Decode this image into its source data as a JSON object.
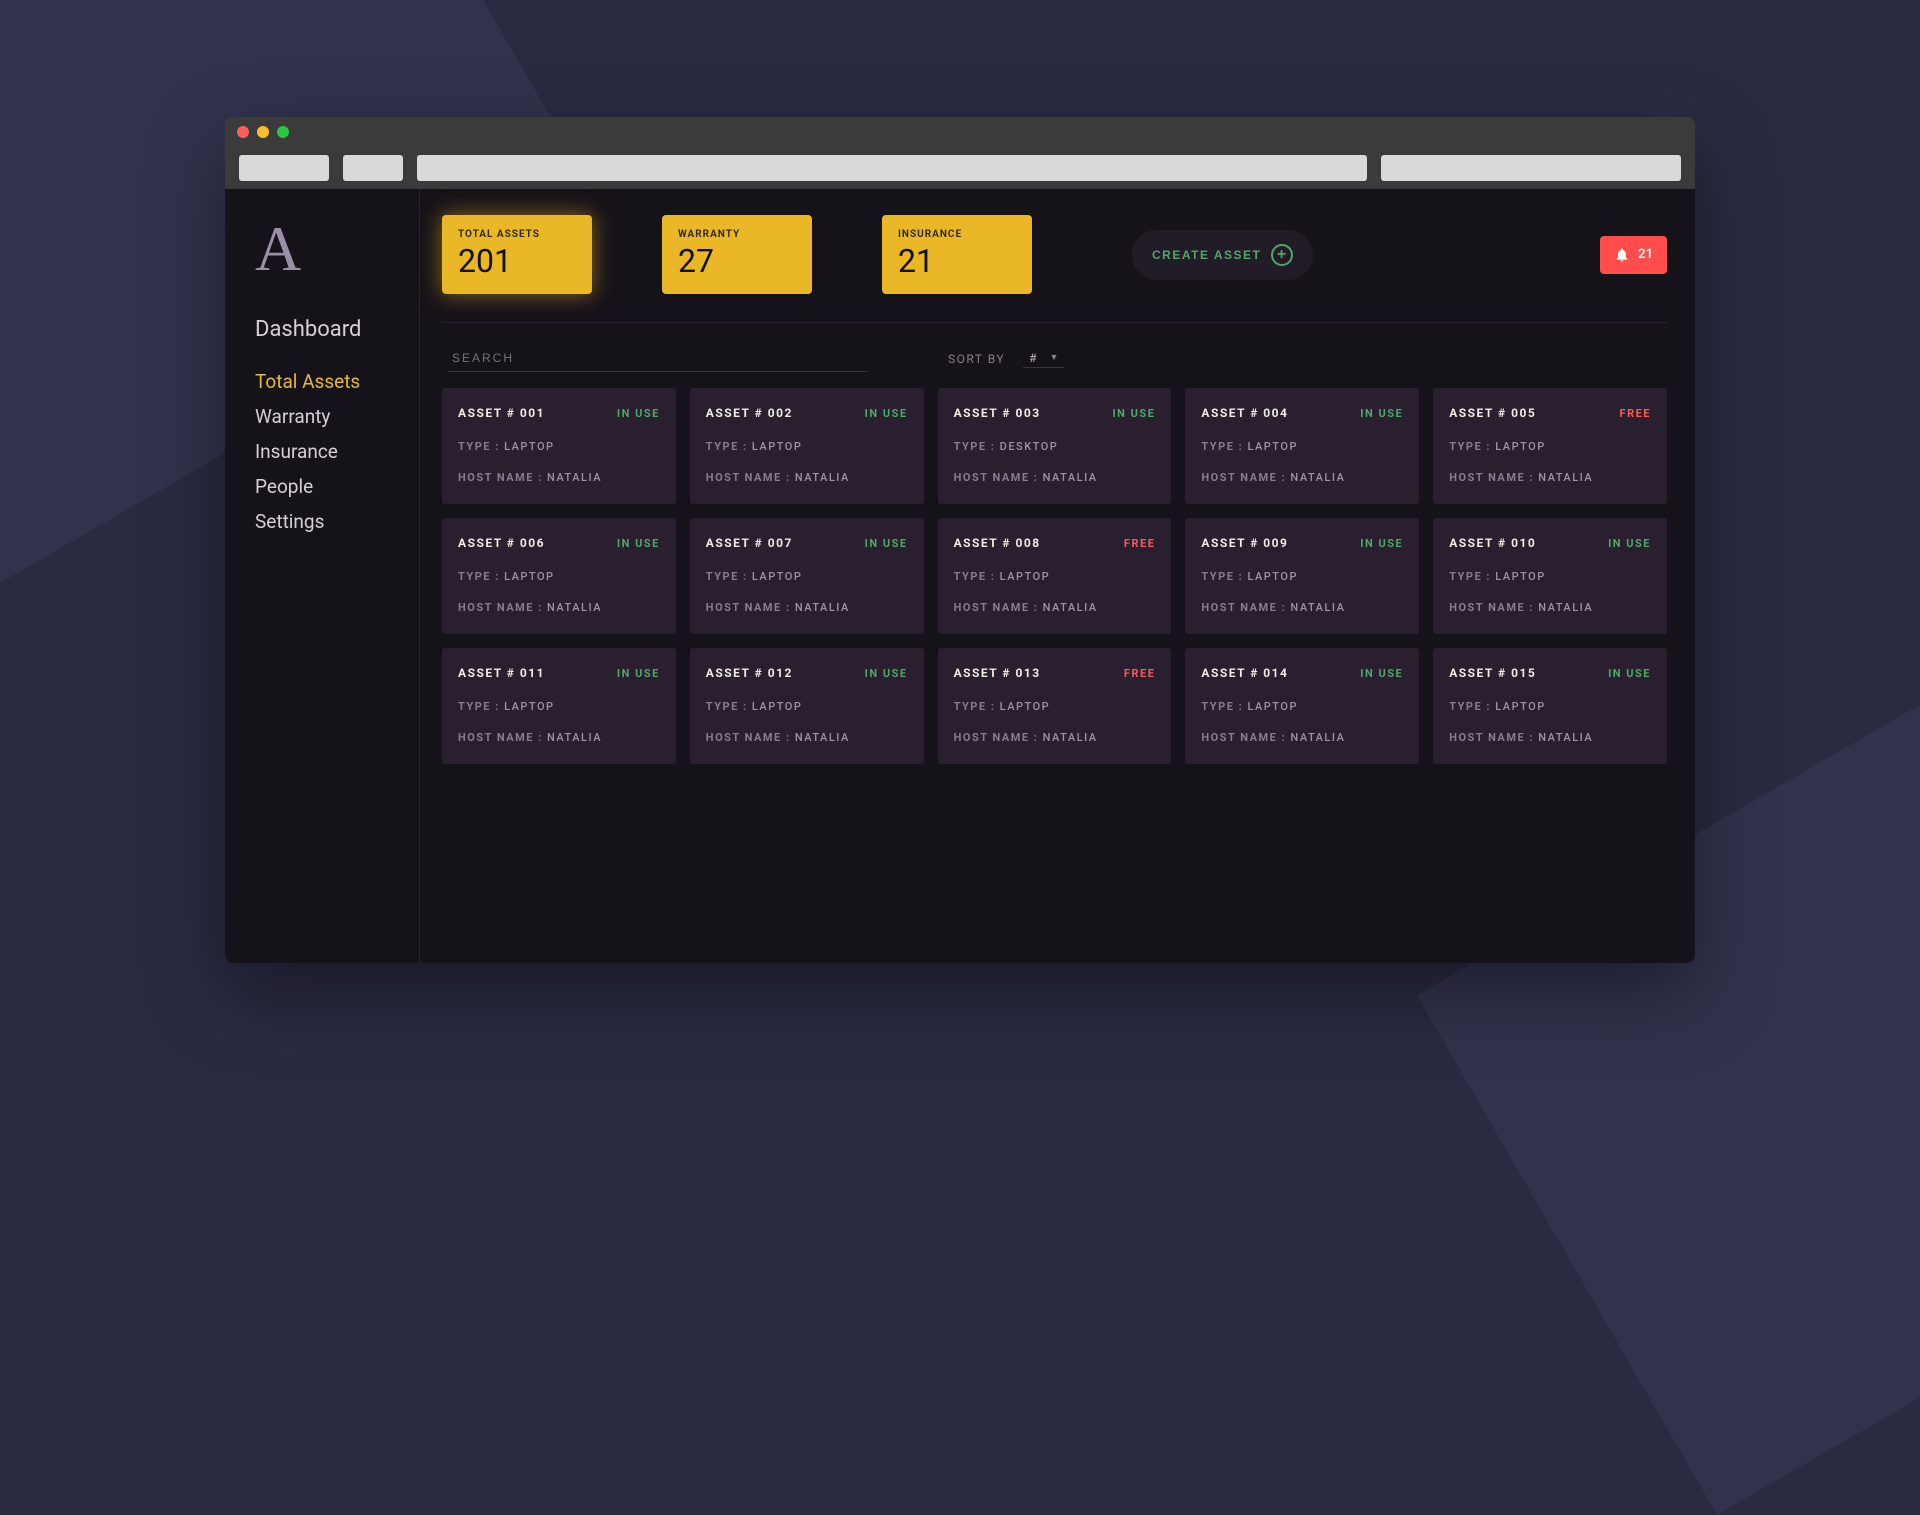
{
  "logo": "A",
  "nav": {
    "dashboard": "Dashboard",
    "total_assets": "Total Assets",
    "warranty": "Warranty",
    "insurance": "Insurance",
    "people": "People",
    "settings": "Settings"
  },
  "stats": {
    "total_assets": {
      "label": "TOTAL ASSETS",
      "value": "201"
    },
    "warranty": {
      "label": "WARRANTY",
      "value": "27"
    },
    "insurance": {
      "label": "INSURANCE",
      "value": "21"
    }
  },
  "create_label": "CREATE ASSET",
  "notif_count": "21",
  "search_placeholder": "SEARCH",
  "sort_label": "SORT BY",
  "sort_value": "#",
  "labels": {
    "type": "TYPE :",
    "host": "HOST NAME :"
  },
  "assets": [
    {
      "id": "ASSET # 001",
      "status": "IN USE",
      "status_kind": "inuse",
      "type": "LAPTOP",
      "host": "NATALIA"
    },
    {
      "id": "ASSET # 002",
      "status": "IN USE",
      "status_kind": "inuse",
      "type": "LAPTOP",
      "host": "NATALIA"
    },
    {
      "id": "ASSET # 003",
      "status": "IN USE",
      "status_kind": "inuse",
      "type": "DESKTOP",
      "host": "NATALIA"
    },
    {
      "id": "ASSET # 004",
      "status": "IN USE",
      "status_kind": "inuse",
      "type": "LAPTOP",
      "host": "NATALIA"
    },
    {
      "id": "ASSET # 005",
      "status": "FREE",
      "status_kind": "free",
      "type": "LAPTOP",
      "host": "NATALIA"
    },
    {
      "id": "ASSET # 006",
      "status": "IN USE",
      "status_kind": "inuse",
      "type": "LAPTOP",
      "host": "NATALIA"
    },
    {
      "id": "ASSET # 007",
      "status": "IN USE",
      "status_kind": "inuse",
      "type": "LAPTOP",
      "host": "NATALIA"
    },
    {
      "id": "ASSET # 008",
      "status": "FREE",
      "status_kind": "free",
      "type": "LAPTOP",
      "host": "NATALIA"
    },
    {
      "id": "ASSET # 009",
      "status": "IN USE",
      "status_kind": "inuse",
      "type": "LAPTOP",
      "host": "NATALIA"
    },
    {
      "id": "ASSET # 010",
      "status": "IN USE",
      "status_kind": "inuse",
      "type": "LAPTOP",
      "host": "NATALIA"
    },
    {
      "id": "ASSET # 011",
      "status": "IN USE",
      "status_kind": "inuse",
      "type": "LAPTOP",
      "host": "NATALIA"
    },
    {
      "id": "ASSET # 012",
      "status": "IN USE",
      "status_kind": "inuse",
      "type": "LAPTOP",
      "host": "NATALIA"
    },
    {
      "id": "ASSET # 013",
      "status": "FREE",
      "status_kind": "free",
      "type": "LAPTOP",
      "host": "NATALIA"
    },
    {
      "id": "ASSET # 014",
      "status": "IN USE",
      "status_kind": "inuse",
      "type": "LAPTOP",
      "host": "NATALIA"
    },
    {
      "id": "ASSET # 015",
      "status": "IN USE",
      "status_kind": "inuse",
      "type": "LAPTOP",
      "host": "NATALIA"
    }
  ]
}
